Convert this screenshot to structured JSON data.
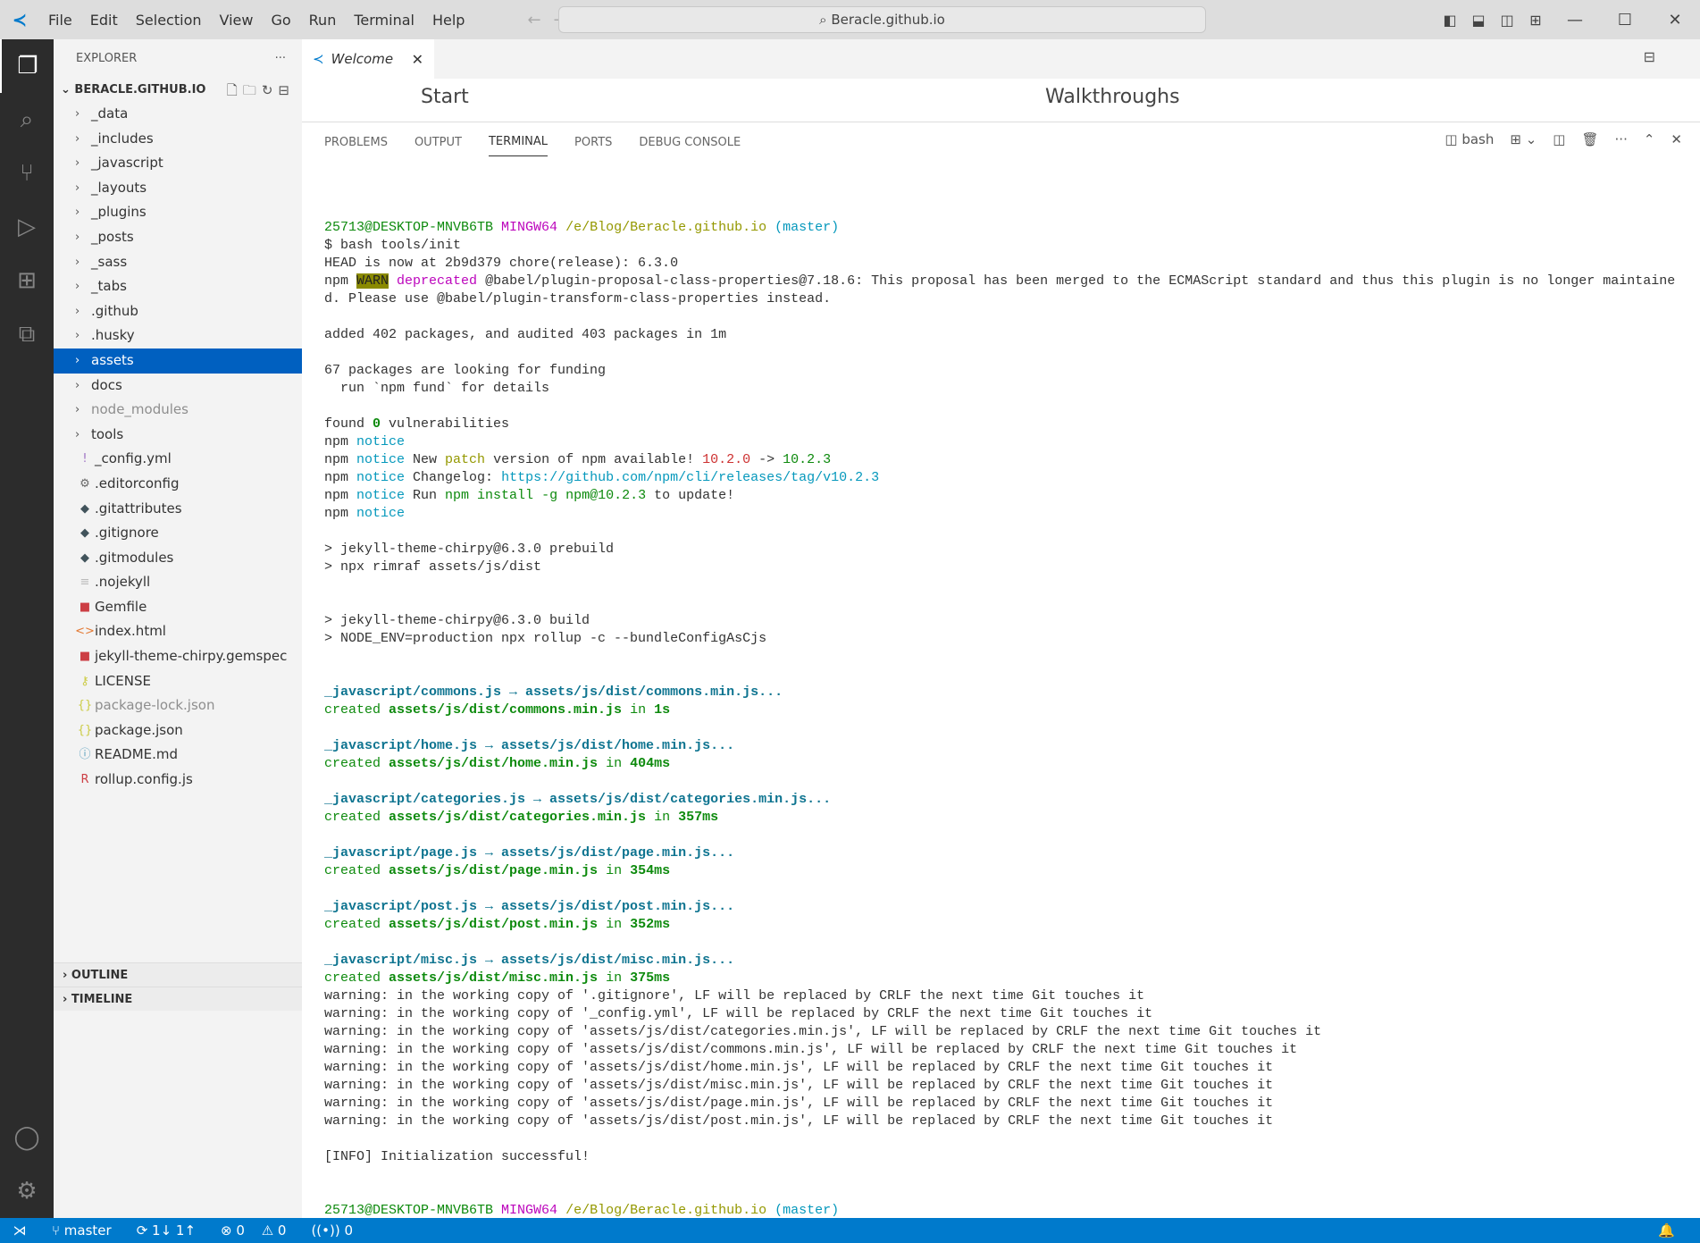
{
  "titlebar": {
    "menu": [
      "File",
      "Edit",
      "Selection",
      "View",
      "Go",
      "Run",
      "Terminal",
      "Help"
    ],
    "search": "Beracle.github.io"
  },
  "explorer": {
    "title": "EXPLORER",
    "root": "BERACLE.GITHUB.IO",
    "items": [
      {
        "label": "_data",
        "type": "folder"
      },
      {
        "label": "_includes",
        "type": "folder"
      },
      {
        "label": "_javascript",
        "type": "folder"
      },
      {
        "label": "_layouts",
        "type": "folder"
      },
      {
        "label": "_plugins",
        "type": "folder"
      },
      {
        "label": "_posts",
        "type": "folder"
      },
      {
        "label": "_sass",
        "type": "folder"
      },
      {
        "label": "_tabs",
        "type": "folder"
      },
      {
        "label": ".github",
        "type": "folder"
      },
      {
        "label": ".husky",
        "type": "folder"
      },
      {
        "label": "assets",
        "type": "folder",
        "selected": true
      },
      {
        "label": "docs",
        "type": "folder"
      },
      {
        "label": "node_modules",
        "type": "folder",
        "dim": true
      },
      {
        "label": "tools",
        "type": "folder"
      },
      {
        "label": "_config.yml",
        "icon": "!",
        "color": "#a074c4"
      },
      {
        "label": ".editorconfig",
        "icon": "⚙",
        "color": "#666"
      },
      {
        "label": ".gitattributes",
        "icon": "◆",
        "color": "#41535b"
      },
      {
        "label": ".gitignore",
        "icon": "◆",
        "color": "#41535b"
      },
      {
        "label": ".gitmodules",
        "icon": "◆",
        "color": "#41535b"
      },
      {
        "label": ".nojekyll",
        "icon": "≡",
        "color": "#bbb"
      },
      {
        "label": "Gemfile",
        "icon": "■",
        "color": "#cc3e44"
      },
      {
        "label": "index.html",
        "icon": "<>",
        "color": "#e37933"
      },
      {
        "label": "jekyll-theme-chirpy.gemspec",
        "icon": "■",
        "color": "#cc3e44"
      },
      {
        "label": "LICENSE",
        "icon": "⚷",
        "color": "#cbcb41"
      },
      {
        "label": "package-lock.json",
        "icon": "{}",
        "color": "#cbcb41",
        "dim": true
      },
      {
        "label": "package.json",
        "icon": "{}",
        "color": "#cbcb41"
      },
      {
        "label": "README.md",
        "icon": "ⓘ",
        "color": "#519aba"
      },
      {
        "label": "rollup.config.js",
        "icon": "R",
        "color": "#cc3e44"
      }
    ],
    "outline": "OUTLINE",
    "timeline": "TIMELINE"
  },
  "editor": {
    "tab": "Welcome",
    "welcome": {
      "start": "Start",
      "walkthroughs": "Walkthroughs"
    }
  },
  "panel": {
    "tabs": [
      "PROBLEMS",
      "OUTPUT",
      "TERMINAL",
      "PORTS",
      "DEBUG CONSOLE"
    ],
    "active": "TERMINAL",
    "shell": "bash"
  },
  "colors": {
    "green": "#0d8a0d",
    "magenta": "#bc05bc",
    "yellow": "#949800",
    "cyan": "#0598bc",
    "red": "#cd3131",
    "teal": "#0e7490",
    "accent": "#007acc"
  },
  "terminal": [
    [],
    [
      [
        "25713@DESKTOP-MNVB6TB",
        "g"
      ],
      [
        " "
      ],
      [
        "MINGW64",
        "m"
      ],
      [
        " "
      ],
      [
        "/e/Blog/Beracle.github.io",
        "y"
      ],
      [
        " "
      ],
      [
        "(master)",
        "c"
      ]
    ],
    [
      [
        "$ bash tools/init"
      ]
    ],
    [
      [
        "HEAD is now at 2b9d379 chore(release): 6.3.0"
      ]
    ],
    [
      [
        "npm "
      ],
      [
        "WARN",
        "warn"
      ],
      [
        " "
      ],
      [
        "deprecated",
        "m"
      ],
      [
        " @babel/plugin-proposal-class-properties@7.18.6: This proposal has been merged to the ECMAScript standard and thus this plugin is no longer maintaine"
      ]
    ],
    [
      [
        "d. Please use @babel/plugin-transform-class-properties instead."
      ]
    ],
    [],
    [
      [
        "added 402 packages, and audited 403 packages in 1m"
      ]
    ],
    [],
    [
      [
        "67 packages are looking for funding"
      ]
    ],
    [
      [
        "  run `npm fund` for details"
      ]
    ],
    [],
    [
      [
        "found "
      ],
      [
        "0",
        "gb"
      ],
      [
        " vulnerabilities"
      ]
    ],
    [
      [
        "npm "
      ],
      [
        "notice",
        "c"
      ]
    ],
    [
      [
        "npm "
      ],
      [
        "notice",
        "c"
      ],
      [
        " New "
      ],
      [
        "patch",
        "y"
      ],
      [
        " version of npm available! "
      ],
      [
        "10.2.0",
        "r"
      ],
      [
        " -> "
      ],
      [
        "10.2.3",
        "g"
      ]
    ],
    [
      [
        "npm "
      ],
      [
        "notice",
        "c"
      ],
      [
        " Changelog: "
      ],
      [
        "https://github.com/npm/cli/releases/tag/v10.2.3",
        "c"
      ]
    ],
    [
      [
        "npm "
      ],
      [
        "notice",
        "c"
      ],
      [
        " Run "
      ],
      [
        "npm install -g npm@10.2.3",
        "g"
      ],
      [
        " to update!"
      ]
    ],
    [
      [
        "npm "
      ],
      [
        "notice",
        "c"
      ]
    ],
    [],
    [
      [
        "> jekyll-theme-chirpy@6.3.0 prebuild"
      ]
    ],
    [
      [
        "> npx rimraf assets/js/dist"
      ]
    ],
    [],
    [],
    [
      [
        "> jekyll-theme-chirpy@6.3.0 build"
      ]
    ],
    [
      [
        "> NODE_ENV=production npx rollup -c --bundleConfigAsCjs"
      ]
    ],
    [],
    [],
    [
      [
        "_javascript/commons.js → assets/js/dist/commons.min.js...",
        "tb"
      ]
    ],
    [
      [
        "created ",
        "g"
      ],
      [
        "assets/js/dist/commons.min.js",
        "gb"
      ],
      [
        " in ",
        "g"
      ],
      [
        "1s",
        "gb"
      ]
    ],
    [],
    [
      [
        "_javascript/home.js → assets/js/dist/home.min.js...",
        "tb"
      ]
    ],
    [
      [
        "created ",
        "g"
      ],
      [
        "assets/js/dist/home.min.js",
        "gb"
      ],
      [
        " in ",
        "g"
      ],
      [
        "404ms",
        "gb"
      ]
    ],
    [],
    [
      [
        "_javascript/categories.js → assets/js/dist/categories.min.js...",
        "tb"
      ]
    ],
    [
      [
        "created ",
        "g"
      ],
      [
        "assets/js/dist/categories.min.js",
        "gb"
      ],
      [
        " in ",
        "g"
      ],
      [
        "357ms",
        "gb"
      ]
    ],
    [],
    [
      [
        "_javascript/page.js → assets/js/dist/page.min.js...",
        "tb"
      ]
    ],
    [
      [
        "created ",
        "g"
      ],
      [
        "assets/js/dist/page.min.js",
        "gb"
      ],
      [
        " in ",
        "g"
      ],
      [
        "354ms",
        "gb"
      ]
    ],
    [],
    [
      [
        "_javascript/post.js → assets/js/dist/post.min.js...",
        "tb"
      ]
    ],
    [
      [
        "created ",
        "g"
      ],
      [
        "assets/js/dist/post.min.js",
        "gb"
      ],
      [
        " in ",
        "g"
      ],
      [
        "352ms",
        "gb"
      ]
    ],
    [],
    [
      [
        "_javascript/misc.js → assets/js/dist/misc.min.js...",
        "tb"
      ]
    ],
    [
      [
        "created ",
        "g"
      ],
      [
        "assets/js/dist/misc.min.js",
        "gb"
      ],
      [
        " in ",
        "g"
      ],
      [
        "375ms",
        "gb"
      ]
    ],
    [
      [
        "warning: in the working copy of '.gitignore', LF will be replaced by CRLF the next time Git touches it"
      ]
    ],
    [
      [
        "warning: in the working copy of '_config.yml', LF will be replaced by CRLF the next time Git touches it"
      ]
    ],
    [
      [
        "warning: in the working copy of 'assets/js/dist/categories.min.js', LF will be replaced by CRLF the next time Git touches it"
      ]
    ],
    [
      [
        "warning: in the working copy of 'assets/js/dist/commons.min.js', LF will be replaced by CRLF the next time Git touches it"
      ]
    ],
    [
      [
        "warning: in the working copy of 'assets/js/dist/home.min.js', LF will be replaced by CRLF the next time Git touches it"
      ]
    ],
    [
      [
        "warning: in the working copy of 'assets/js/dist/misc.min.js', LF will be replaced by CRLF the next time Git touches it"
      ]
    ],
    [
      [
        "warning: in the working copy of 'assets/js/dist/page.min.js', LF will be replaced by CRLF the next time Git touches it"
      ]
    ],
    [
      [
        "warning: in the working copy of 'assets/js/dist/post.min.js', LF will be replaced by CRLF the next time Git touches it"
      ]
    ],
    [],
    [
      [
        "[INFO] Initialization successful!"
      ]
    ],
    [],
    [],
    [
      [
        "25713@DESKTOP-MNVB6TB",
        "g"
      ],
      [
        " "
      ],
      [
        "MINGW64",
        "m"
      ],
      [
        " "
      ],
      [
        "/e/Blog/Beracle.github.io",
        "y"
      ],
      [
        " "
      ],
      [
        "(master)",
        "c"
      ]
    ],
    [
      [
        "$"
      ]
    ]
  ],
  "statusbar": {
    "branch": "master",
    "sync": "1↓ 1↑",
    "errors": "0",
    "warnings": "0",
    "ports": "0"
  }
}
